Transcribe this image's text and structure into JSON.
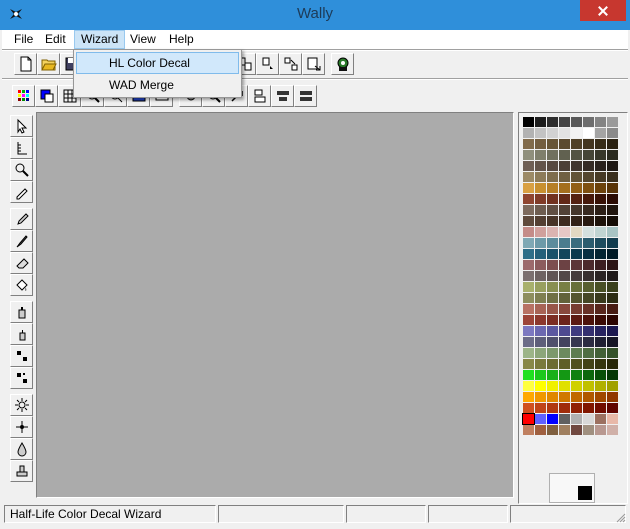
{
  "window": {
    "title": "Wally",
    "icon": "wally-bird-icon"
  },
  "menubar": {
    "items": [
      "File",
      "Edit",
      "Wizard",
      "View",
      "Help"
    ],
    "open_index": 2
  },
  "wizard_menu": {
    "items": [
      "HL Color Decal",
      "WAD Merge"
    ],
    "highlighted_index": 0
  },
  "toolbar1": {
    "icons": [
      "new-file-icon",
      "open-folder-icon",
      "save-icon",
      "copy-icon",
      "paste-icon",
      "undo-icon",
      "redo-icon",
      "cut-icon",
      "image-properties-icon",
      "rotate-image-icon",
      "flip-image-icon",
      "tile-image-icon",
      "export-icon",
      "decal-wizard-icon"
    ]
  },
  "toolbar2": {
    "icons": [
      "palette-icon",
      "color-swap-icon",
      "grid-icon",
      "zoom-in-icon",
      "zoom-out-icon",
      "tile-view-icon",
      "screen-icon",
      "brightness-icon",
      "magnify-icon",
      "rotate-icon",
      "align-left-icon",
      "align-center-icon",
      "align-right-icon"
    ]
  },
  "toolbox": {
    "tools": [
      "pointer-tool-icon",
      "ruler-tool-icon",
      "zoom-tool-icon",
      "eyedropper-tool-icon",
      "pencil-tool-icon",
      "brush-tool-icon",
      "eraser-tool-icon",
      "fill-tool-icon",
      "spray-tool-icon",
      "spray-small-tool-icon",
      "dither-tool-icon",
      "pattern-tool-icon",
      "burst-tool-icon",
      "sparkle-tool-icon",
      "drop-tool-icon",
      "stamp-tool-icon"
    ]
  },
  "palette": {
    "colors": [
      "#000000",
      "#1d1d1d",
      "#2e2e2e",
      "#444444",
      "#585858",
      "#6d6d6d",
      "#838383",
      "#9a9a9a",
      "#b2b2b2",
      "#c3c3c3",
      "#d2d2d2",
      "#e2e2e2",
      "#f2f2f2",
      "#ffffff",
      "#a4a4a4",
      "#8a8a8a",
      "#806a4a",
      "#735e40",
      "#675537",
      "#5b4a2f",
      "#4f4027",
      "#43351f",
      "#372c18",
      "#2b2212",
      "#8f8f7c",
      "#7f7f6c",
      "#70705e",
      "#616150",
      "#535343",
      "#454536",
      "#37372a",
      "#2a2a1f",
      "#6f5f55",
      "#63544a",
      "#574940",
      "#4b3f37",
      "#40352e",
      "#352b25",
      "#2a221d",
      "#1f1915",
      "#9c8a66",
      "#8d7b59",
      "#7e6d4d",
      "#706043",
      "#625338",
      "#54462f",
      "#473a26",
      "#3a2f1e",
      "#d9a042",
      "#c8902f",
      "#b67f26",
      "#a46f1e",
      "#925f17",
      "#7f5011",
      "#6c420b",
      "#593407",
      "#8f4530",
      "#803b27",
      "#71321f",
      "#622917",
      "#542111",
      "#46190b",
      "#381206",
      "#2b0b02",
      "#7d6b5e",
      "#6e5d50",
      "#604f43",
      "#524236",
      "#45362b",
      "#382a20",
      "#2c1f16",
      "#20150d",
      "#5e4a3c",
      "#533f32",
      "#483528",
      "#3d2b1f",
      "#322217",
      "#281a10",
      "#1e130a",
      "#140c05",
      "#c48c88",
      "#d0a09c",
      "#dbb4b1",
      "#e6c8c6",
      "#e2d8c2",
      "#d4e0de",
      "#c0d4d2",
      "#a8c4c4",
      "#7fa8b4",
      "#6d9aa8",
      "#5c8c9c",
      "#4a7c8e",
      "#3a6c7e",
      "#2b5c6e",
      "#1e4c5e",
      "#123c4e",
      "#2e6e88",
      "#24607a",
      "#1a526a",
      "#12465c",
      "#0c3a4e",
      "#072e40",
      "#032432",
      "#001a26",
      "#9c6a6c",
      "#8c5c5e",
      "#7c4e50",
      "#6c4244",
      "#5c3638",
      "#4c2a2c",
      "#3c1f21",
      "#2c1516",
      "#7c7070",
      "#6e6262",
      "#605454",
      "#524747",
      "#453b3b",
      "#382f2f",
      "#2b2424",
      "#1f1a1a",
      "#a8b06c",
      "#989f5e",
      "#888f51",
      "#787f45",
      "#686f3a",
      "#585f2f",
      "#495025",
      "#3a401c",
      "#8e8e5e",
      "#7f7f51",
      "#707045",
      "#62623a",
      "#54542f",
      "#464625",
      "#39391c",
      "#2c2c13",
      "#b87264",
      "#a86456",
      "#985649",
      "#88493d",
      "#783d32",
      "#683127",
      "#58261d",
      "#481c13",
      "#9c4438",
      "#8c382d",
      "#7c2d23",
      "#6c231a",
      "#5c1a12",
      "#4c120b",
      "#3c0b05",
      "#2c0501",
      "#7c78c0",
      "#6c68b0",
      "#5c58a0",
      "#4e4a90",
      "#403c80",
      "#332f70",
      "#272360",
      "#1c1850",
      "#6c6c88",
      "#5e5e7a",
      "#50506c",
      "#43435e",
      "#373750",
      "#2b2b42",
      "#202034",
      "#161626",
      "#9cb488",
      "#8ca67a",
      "#7c986c",
      "#6c8a5e",
      "#5e7c50",
      "#506e43",
      "#426036",
      "#35522a",
      "#888848",
      "#7a7a3c",
      "#6c6c31",
      "#5e5e27",
      "#50501e",
      "#424216",
      "#35350f",
      "#282809",
      "#20e020",
      "#1cc81c",
      "#18b018",
      "#149814",
      "#108010",
      "#0c680c",
      "#085008",
      "#043804",
      "#ffff40",
      "#ffff00",
      "#f0f000",
      "#e0e000",
      "#d0d000",
      "#c0c000",
      "#b0b000",
      "#a0a000",
      "#ffa800",
      "#f09800",
      "#e08800",
      "#d07800",
      "#c06800",
      "#b05800",
      "#a04800",
      "#903800",
      "#d05020",
      "#c04418",
      "#b03810",
      "#a02c0a",
      "#902004",
      "#801600",
      "#700c00",
      "#600400",
      "#ff0000",
      "#6060ff",
      "#0000ff",
      "#606060",
      "#b0b0b0",
      "#d8d8d8",
      "#9c7060",
      "#e8b8a8",
      "#c08060",
      "#a06040",
      "#806040",
      "#a08060",
      "#704840",
      "#a09080",
      "#b89890",
      "#d0b0a8"
    ],
    "selected_index": 216
  },
  "statusbar": {
    "text": "Half-Life Color Decal Wizard"
  }
}
